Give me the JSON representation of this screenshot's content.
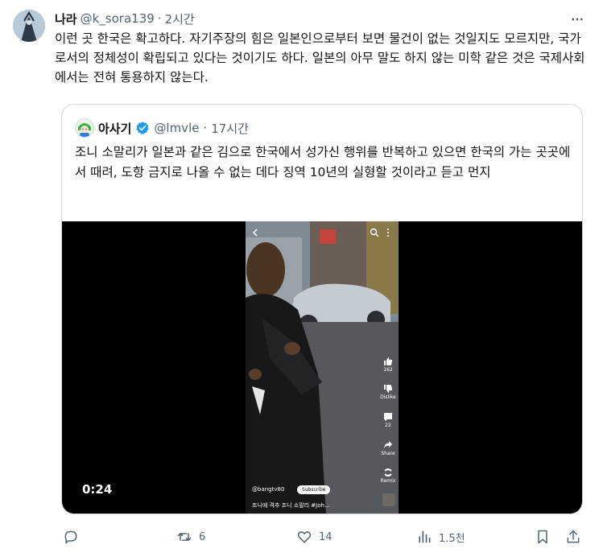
{
  "author": {
    "name": "나라",
    "handle": "@k_sora139",
    "separator": "·",
    "time": "2시간",
    "text": "이런 곳 한국은 확고하다. 자기주장의 힘은 일본인으로부터 보면 물건이 없는 것일지도 모르지만, 국가로서의 정체성이 확립되고 있다는 것이기도 하다. 일본의 아무 말도 하지 않는 미학 같은 것은 국제사회에서는 전혀 통용하지 않는다."
  },
  "quote": {
    "name": "아사기",
    "handle": "@lmvle",
    "separator": "·",
    "time": "17시간",
    "verified_color": "#1d9bf0",
    "text": "조니 소말리가 일본과 같은 김으로 한국에서 성가신 행위를 반복하고 있으면 한국의 가는 곳곳에서 때려, 도항 금지로 나올 수 없는 데다 징역 10년의 실형할 것이라고 듣고 먼지"
  },
  "video": {
    "duration": "0:24",
    "like_count": "162",
    "dislike_label": "Dislike",
    "comment_count": "22",
    "share_label": "Share",
    "remix_label": "Remix",
    "channel": "@bangtv80",
    "subscribe_label": "Subscribe",
    "caption": "조니에 격추 조니 소말리 #Joh..."
  },
  "actions": {
    "replies": "",
    "retweets": "6",
    "likes": "14",
    "views": "1.5천"
  },
  "colors": {
    "text": "#0f1419",
    "secondary": "#536471",
    "border": "#cfd9de"
  }
}
